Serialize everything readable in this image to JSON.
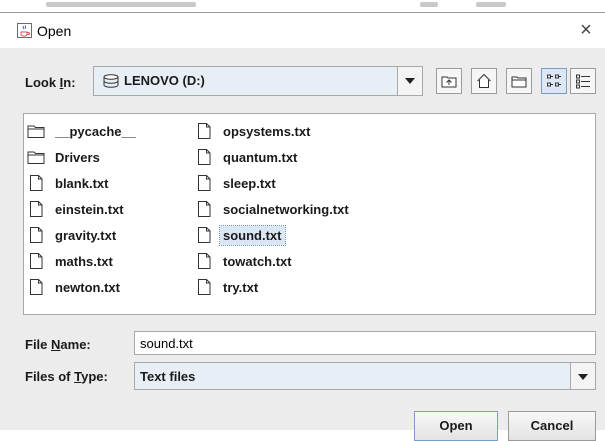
{
  "dialog": {
    "title": "Open",
    "title_icon": "java-icon",
    "close_glyph": "×"
  },
  "look_in": {
    "label_prefix": "Look ",
    "label_mnemonic": "I",
    "label_suffix": "n:",
    "value": "LENOVO (D:)",
    "icon": "drive-icon"
  },
  "toolbar": {
    "buttons": [
      "up-one-level-icon",
      "home-icon",
      "new-folder-icon",
      "list-view-icon",
      "details-view-icon"
    ]
  },
  "files": {
    "column1": [
      {
        "name": "__pycache__",
        "type": "folder"
      },
      {
        "name": "Drivers",
        "type": "folder"
      },
      {
        "name": "blank.txt",
        "type": "file"
      },
      {
        "name": "einstein.txt",
        "type": "file"
      },
      {
        "name": "gravity.txt",
        "type": "file"
      },
      {
        "name": "maths.txt",
        "type": "file"
      },
      {
        "name": "newton.txt",
        "type": "file"
      }
    ],
    "column2": [
      {
        "name": "opsystems.txt",
        "type": "file"
      },
      {
        "name": "quantum.txt",
        "type": "file"
      },
      {
        "name": "sleep.txt",
        "type": "file"
      },
      {
        "name": "socialnetworking.txt",
        "type": "file"
      },
      {
        "name": "sound.txt",
        "type": "file",
        "selected": true
      },
      {
        "name": "towatch.txt",
        "type": "file"
      },
      {
        "name": "try.txt",
        "type": "file"
      }
    ]
  },
  "file_name": {
    "label_prefix": "File ",
    "label_mnemonic": "N",
    "label_suffix": "ame:",
    "value": "sound.txt"
  },
  "file_type": {
    "label_prefix": "Files of ",
    "label_mnemonic": "T",
    "label_suffix": "ype:",
    "value": "Text files"
  },
  "actions": {
    "open_label": "Open",
    "cancel_label": "Cancel"
  },
  "colors": {
    "selection": "#dbe6f4",
    "dialog_bg": "#ececec"
  }
}
